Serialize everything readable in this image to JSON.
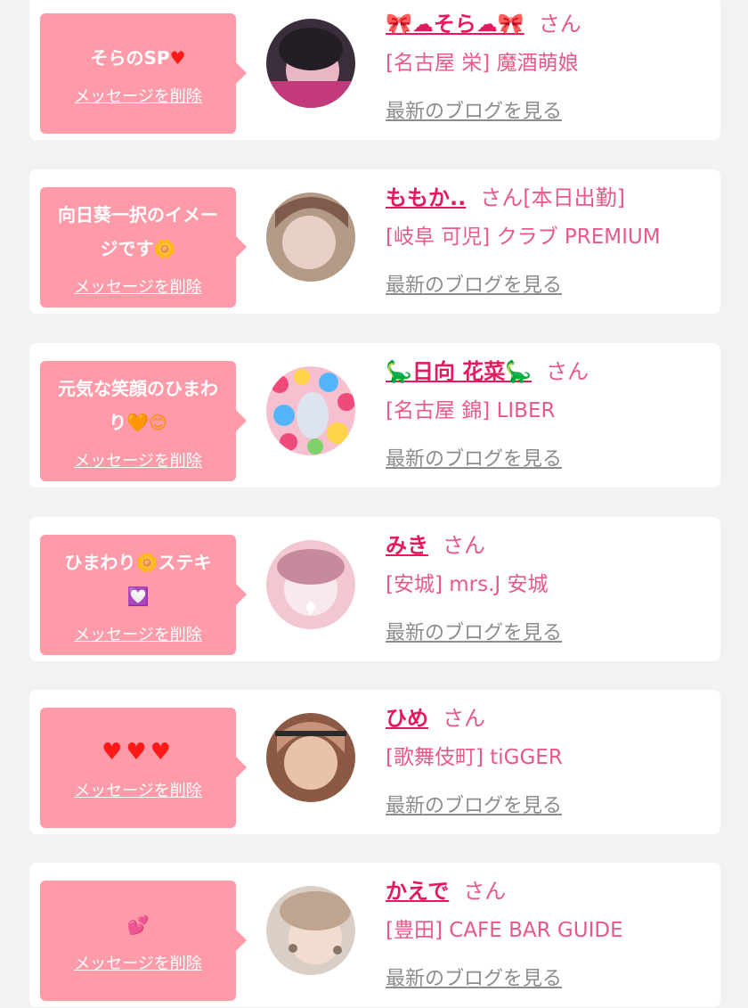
{
  "items": [
    {
      "message_text": "そらのSP",
      "message_emoji": "♥",
      "delete_label": "メッセージを削除",
      "name": "🎀☁そら☁🎀",
      "honorific": "さん",
      "suffix": "",
      "shop": "[名古屋 栄] 魔酒萌娘",
      "blog_label": "最新のブログを見る",
      "avatar_colors": [
        "#3a2e3a",
        "#e9b6c3",
        "#c23a7a"
      ]
    },
    {
      "message_text": "向日葵一択のイメージです",
      "message_emoji": "🌼",
      "delete_label": "メッセージを削除",
      "name": "ももか..",
      "honorific": "さん",
      "suffix": "[本日出勤]",
      "shop": "[岐阜 可児] クラブ PREMIUM",
      "blog_label": "最新のブログを見る",
      "avatar_colors": [
        "#b39a86",
        "#e8d0c6",
        "#7e5b4d"
      ]
    },
    {
      "message_text": "元気な笑顔のひまわり",
      "message_emoji": "🧡😊",
      "delete_label": "メッセージを削除",
      "name": "🦕日向 花菜🦕",
      "honorific": "さん",
      "suffix": "",
      "shop": "[名古屋 錦] LIBER",
      "blog_label": "最新のブログを見る",
      "avatar_colors": [
        "#f04a7a",
        "#ffd34a",
        "#54b5ff"
      ]
    },
    {
      "message_text": "ひまわり🌼ステキ",
      "message_emoji": "💟",
      "delete_label": "メッセージを削除",
      "name": "みき",
      "honorific": "さん",
      "suffix": "",
      "shop": "[安城] mrs.J 安城",
      "blog_label": "最新のブログを見る",
      "avatar_colors": [
        "#f2c7d1",
        "#f9e8ee",
        "#c68a9c"
      ]
    },
    {
      "message_text": "",
      "message_emoji": "♥♥♥",
      "delete_label": "メッセージを削除",
      "name": "ひめ",
      "honorific": "さん",
      "suffix": "",
      "shop": "[歌舞伎町] tiGGER",
      "blog_label": "最新のブログを見る",
      "avatar_colors": [
        "#8c5a44",
        "#e8c3aa",
        "#c9927b"
      ]
    },
    {
      "message_text": "",
      "message_emoji": "💕",
      "delete_label": "メッセージを削除",
      "name": "かえで",
      "honorific": "さん",
      "suffix": "",
      "shop": "[豊田] CAFE BAR GUIDE",
      "blog_label": "最新のブログを見る",
      "avatar_colors": [
        "#d9cfc7",
        "#bfa48f",
        "#8a7565"
      ]
    }
  ]
}
